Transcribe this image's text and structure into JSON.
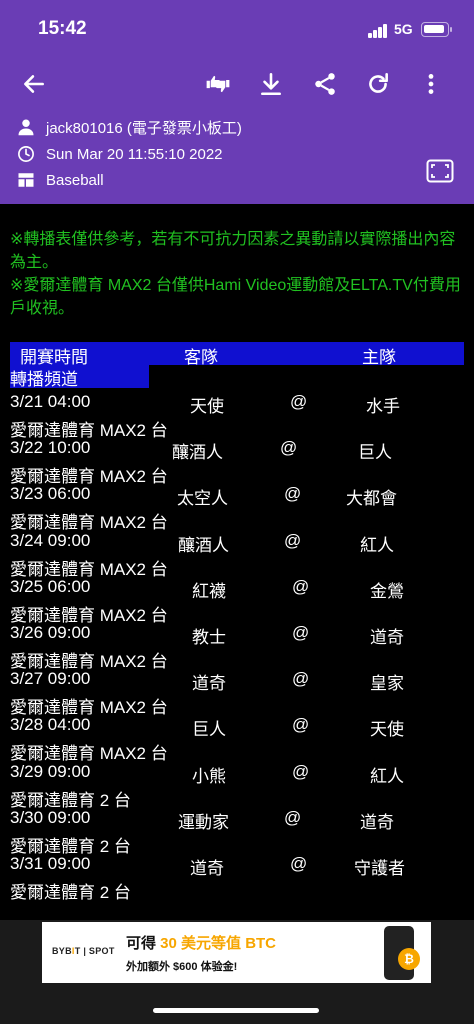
{
  "status_bar": {
    "time": "15:42",
    "network": "5G"
  },
  "toolbar": {
    "icons": [
      "back-arrow-icon",
      "push-pull-icon",
      "download-icon",
      "share-icon",
      "refresh-icon",
      "more-vertical-icon"
    ]
  },
  "post": {
    "author": "jack801016 (電子發票小板工)",
    "datetime": "Sun Mar 20 11:55:10 2022",
    "board": "Baseball"
  },
  "notice": {
    "line1": "※轉播表僅供參考，若有不可抗力因素之異動請以實際播出內容為主。",
    "line2": "※愛爾達體育 MAX2 台僅供Hami Video運動館及ELTA.TV付費用戶收視。"
  },
  "table": {
    "headers": {
      "time": "開賽時間",
      "away": "客隊",
      "home": "主隊",
      "channel": "轉播頻道"
    },
    "rows": [
      {
        "time": "3/21  04:00",
        "away": "天使",
        "at": "@",
        "home": "水手",
        "channel": "愛爾達體育 MAX2 台"
      },
      {
        "time": "3/22  10:00",
        "away": "釀酒人",
        "at": "@",
        "home": "巨人",
        "channel": "愛爾達體育 MAX2 台"
      },
      {
        "time": "3/23  06:00",
        "away": "太空人",
        "at": "@",
        "home": "大都會",
        "channel": "愛爾達體育 MAX2 台"
      },
      {
        "time": "3/24  09:00",
        "away": "釀酒人",
        "at": "@",
        "home": "紅人",
        "channel": "愛爾達體育 MAX2 台"
      },
      {
        "time": "3/25  06:00",
        "away": "紅襪",
        "at": "@",
        "home": "金鶯",
        "channel": "愛爾達體育 MAX2 台"
      },
      {
        "time": "3/26  09:00",
        "away": "教士",
        "at": "@",
        "home": "道奇",
        "channel": "愛爾達體育 MAX2 台"
      },
      {
        "time": "3/27  09:00",
        "away": "道奇",
        "at": "@",
        "home": "皇家",
        "channel": "愛爾達體育 MAX2 台"
      },
      {
        "time": "3/28  04:00",
        "away": "巨人",
        "at": "@",
        "home": "天使",
        "channel": "愛爾達體育 MAX2 台"
      },
      {
        "time": "3/29  09:00",
        "away": "小熊",
        "at": "@",
        "home": "紅人",
        "channel": "愛爾達體育 2 台"
      },
      {
        "time": "3/30  09:00",
        "away": "運動家",
        "at": "@",
        "home": "道奇",
        "channel": "愛爾達體育 2 台"
      },
      {
        "time": "3/31  09:00",
        "away": "道奇",
        "at": "@",
        "home": "守護者",
        "channel": "愛爾達體育 2 台"
      }
    ]
  },
  "ad": {
    "logo_a": "BYB",
    "logo_b": "I",
    "logo_c": "T | SPOT",
    "headline_pre": "可得 ",
    "headline_hl": "30 美元等值 BTC",
    "subline": "外加额外 $600 体验金!",
    "coin_glyph": "₿"
  },
  "colors": {
    "header_bg": "#6a3db5",
    "notice_green": "#21c121",
    "table_header_blue": "#1010d0",
    "accent_orange": "#f7a600"
  }
}
